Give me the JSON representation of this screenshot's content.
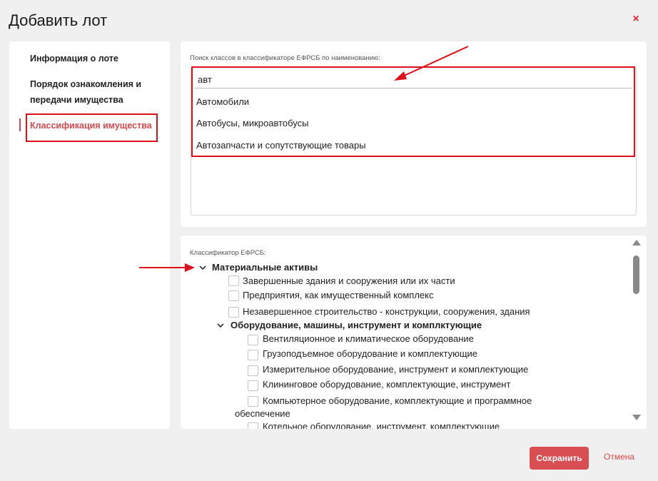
{
  "modal": {
    "title": "Добавить лот",
    "close_symbol": "×"
  },
  "sidebar": {
    "items": [
      {
        "label": "Информация о лоте"
      },
      {
        "label": "Порядок ознакомления и"
      },
      {
        "label": "передачи имущества"
      },
      {
        "label": "Классификация имущества"
      }
    ]
  },
  "search": {
    "label": "Поиск классов в классификаторе ЕФРСБ по наименованию:",
    "value": "авт",
    "suggestions": [
      "Автомобили",
      "Автобусы, микроавтобусы",
      "Автозапчасти и сопутствующие товары"
    ]
  },
  "tree": {
    "label": "Классификатор ЕФРСБ:",
    "rows": [
      "Материальные активы",
      "Завершенные здания и сооружения или их части",
      "Предприятия, как имущественный комплекс",
      "Незавершенное строительство - конструкции, сооружения, здания",
      "Оборудование, машины, инструмент и комплктующие",
      "Вентиляционное и климатическое оборудование",
      "Грузоподъемное оборудование и комплектующие",
      "Измерительное оборудование, инструмент и комплектующие",
      "Клининговое оборудование, комплектующие, инструмент",
      "Компьютерное оборудование, комплектующие и программное",
      "обеспечение",
      "Котельное оборудование, инструмент, комплектующие"
    ]
  },
  "footer": {
    "save_label": "Сохранить",
    "cancel_label": "Отмена"
  },
  "colors": {
    "accent": "#d94e52",
    "highlight": "#e0101a",
    "background": "#f0f0f0"
  }
}
